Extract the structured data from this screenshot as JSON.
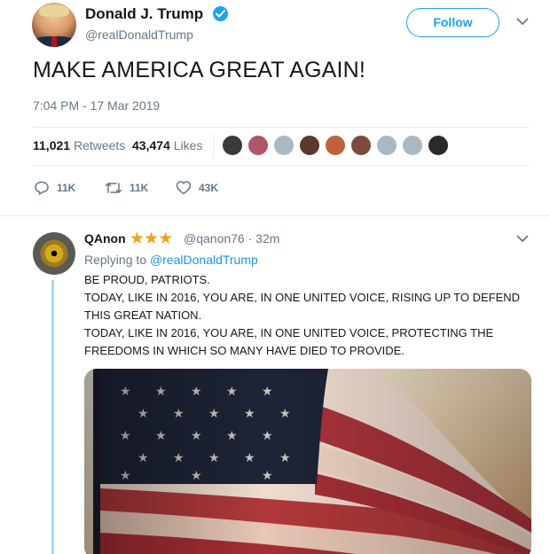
{
  "tweet": {
    "name": "Donald J. Trump",
    "handle": "@realDonaldTrump",
    "follow_label": "Follow",
    "text": "MAKE AMERICA GREAT AGAIN!",
    "timestamp": "7:04 PM - 17 Mar 2019",
    "retweets_count": "11,021",
    "retweets_label": "Retweets",
    "likes_count": "43,474",
    "likes_label": "Likes",
    "actions": {
      "reply_count": "11K",
      "retweet_count": "11K",
      "like_count": "43K"
    },
    "liker_avatars": [
      "#3a3a3a",
      "#b0566a",
      "#aab8c2",
      "#5a3a2a",
      "#c0613a",
      "#7a4a3a",
      "#aab8c2",
      "#aab8c2",
      "#2a2a2a"
    ]
  },
  "reply": {
    "name": "QAnon",
    "stars": "★★★",
    "handle": "@qanon76",
    "time": "· 32m",
    "replying_prefix": "Replying to",
    "replying_to": "@realDonaldTrump",
    "lines": [
      "BE PROUD, PATRIOTS.",
      "TODAY, LIKE IN 2016, YOU ARE, IN ONE UNITED VOICE, RISING UP TO DEFEND",
      "THIS GREAT NATION.",
      "TODAY, LIKE IN 2016, YOU ARE, IN ONE UNITED VOICE, PROTECTING THE",
      "FREEDOMS IN WHICH SO MANY HAVE DIED TO PROVIDE."
    ]
  },
  "colors": {
    "accent": "#1da1f2",
    "secondary_text": "#657786",
    "star": "#f2a11e",
    "thread_line": "#a5d9f6"
  },
  "icons": [
    "verified-badge-icon",
    "chevron-down-icon",
    "reply-icon",
    "retweet-icon",
    "like-icon"
  ]
}
